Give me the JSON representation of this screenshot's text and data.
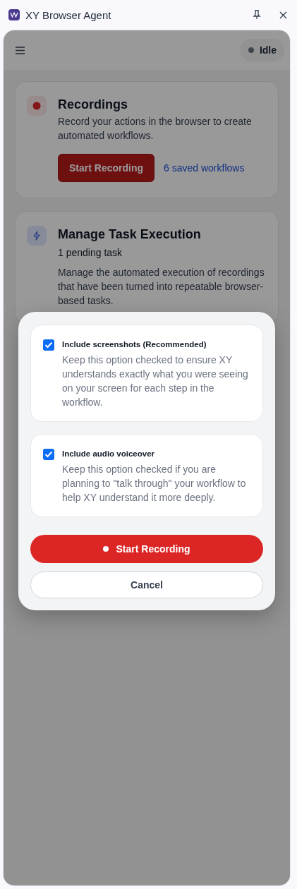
{
  "window": {
    "title": "XY Browser Agent"
  },
  "header": {
    "status": "Idle"
  },
  "cards": [
    {
      "kind": "recordings",
      "title": "Recordings",
      "description": "Record your actions in the browser to create automated workflows.",
      "button": "Start Recording",
      "link": "6 saved workflows"
    },
    {
      "kind": "tasks",
      "title": "Manage Task Execution",
      "subtitle": "1 pending task",
      "description": "Manage the automated execution of recordings that have been turned into repeatable browser-based tasks."
    }
  ],
  "dialog": {
    "options": [
      {
        "label": "Include screenshots (Recommended)",
        "description": "Keep this option checked to ensure XY understands exactly what you were seeing on your screen for each step in the workflow.",
        "checked": true
      },
      {
        "label": "Include audio voiceover",
        "description": "Keep this option checked if you are planning to \"talk through\" your workflow to help XY understand it more deeply.",
        "checked": true
      }
    ],
    "primary_button": "Start Recording",
    "cancel_button": "Cancel"
  }
}
